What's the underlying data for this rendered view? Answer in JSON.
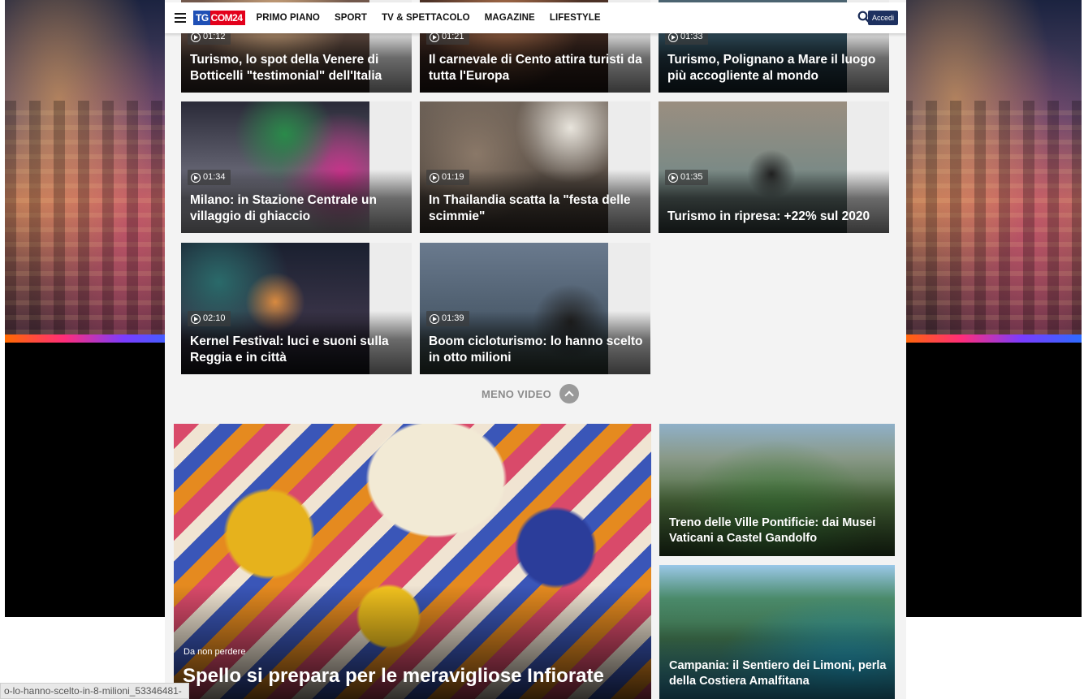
{
  "header": {
    "logo": {
      "part1": "TG",
      "part2": "COM24"
    },
    "nav": [
      "PRIMO PIANO",
      "SPORT",
      "TV & SPETTACOLO",
      "MAGAZINE",
      "LIFESTYLE"
    ],
    "login_label": "Accedi"
  },
  "videos": [
    {
      "duration": "01:12",
      "title": "Turismo, lo spot della Venere di Botticelli \"testimonial\" dell'Italia"
    },
    {
      "duration": "01:21",
      "title": "Il carnevale di Cento attira turisti da tutta l'Europa"
    },
    {
      "duration": "01:33",
      "title": "Turismo, Polignano a Mare il luogo più accogliente al mondo"
    },
    {
      "duration": "01:34",
      "title": "Milano: in Stazione Centrale un villaggio di ghiaccio"
    },
    {
      "duration": "01:19",
      "title": "In Thailandia scatta la \"festa delle scimmie\""
    },
    {
      "duration": "01:35",
      "title": "Turismo in ripresa: +22% sul 2020"
    },
    {
      "duration": "02:10",
      "title": "Kernel Festival: luci e suoni sulla Reggia e in città"
    },
    {
      "duration": "01:39",
      "title": "Boom cicloturismo: lo hanno scelto in otto milioni"
    }
  ],
  "less_videos_label": "MENO VIDEO",
  "feature": {
    "kicker": "Da non perdere",
    "title": "Spello si prepara per le meravigliose Infiorate"
  },
  "side_stories": [
    {
      "title": "Treno delle Ville Pontificie: dai Musei Vaticani a Castel Gandolfo"
    },
    {
      "title": "Campania: il Sentiero dei Limoni, perla della Costiera Amalfitana"
    }
  ],
  "status_bar_url": "o-lo-hanno-scelto-in-8-milioni_53346481-",
  "colors": {
    "brand_blue": "#1e4fb5",
    "brand_red": "#e3001b",
    "login_bg": "#1e3160"
  }
}
